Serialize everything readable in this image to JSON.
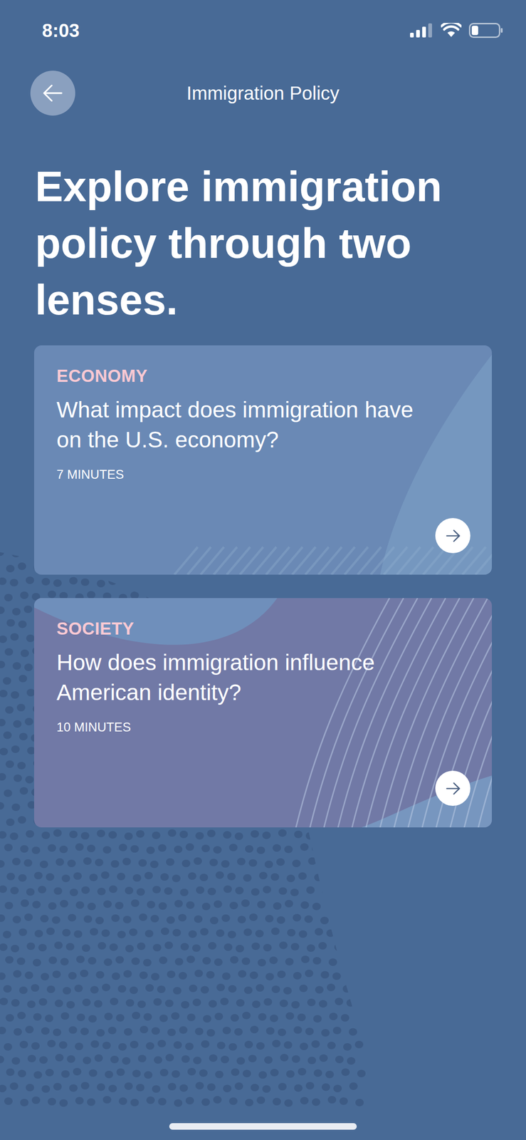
{
  "status_bar": {
    "time": "8:03",
    "battery": {
      "level": 0.25
    }
  },
  "header": {
    "title": "Immigration Policy"
  },
  "heading": "Explore immigration policy through two lenses.",
  "cards": [
    {
      "category": "ECONOMY",
      "question": "What impact does immigration have on the U.S. economy?",
      "duration": "7 MINUTES",
      "color": "#6a89b5",
      "kind": "curve"
    },
    {
      "category": "SOCIETY",
      "question": "How does immigration influence American identity?",
      "duration": "10 MINUTES",
      "color": "#7179a6",
      "kind": "waves"
    }
  ]
}
